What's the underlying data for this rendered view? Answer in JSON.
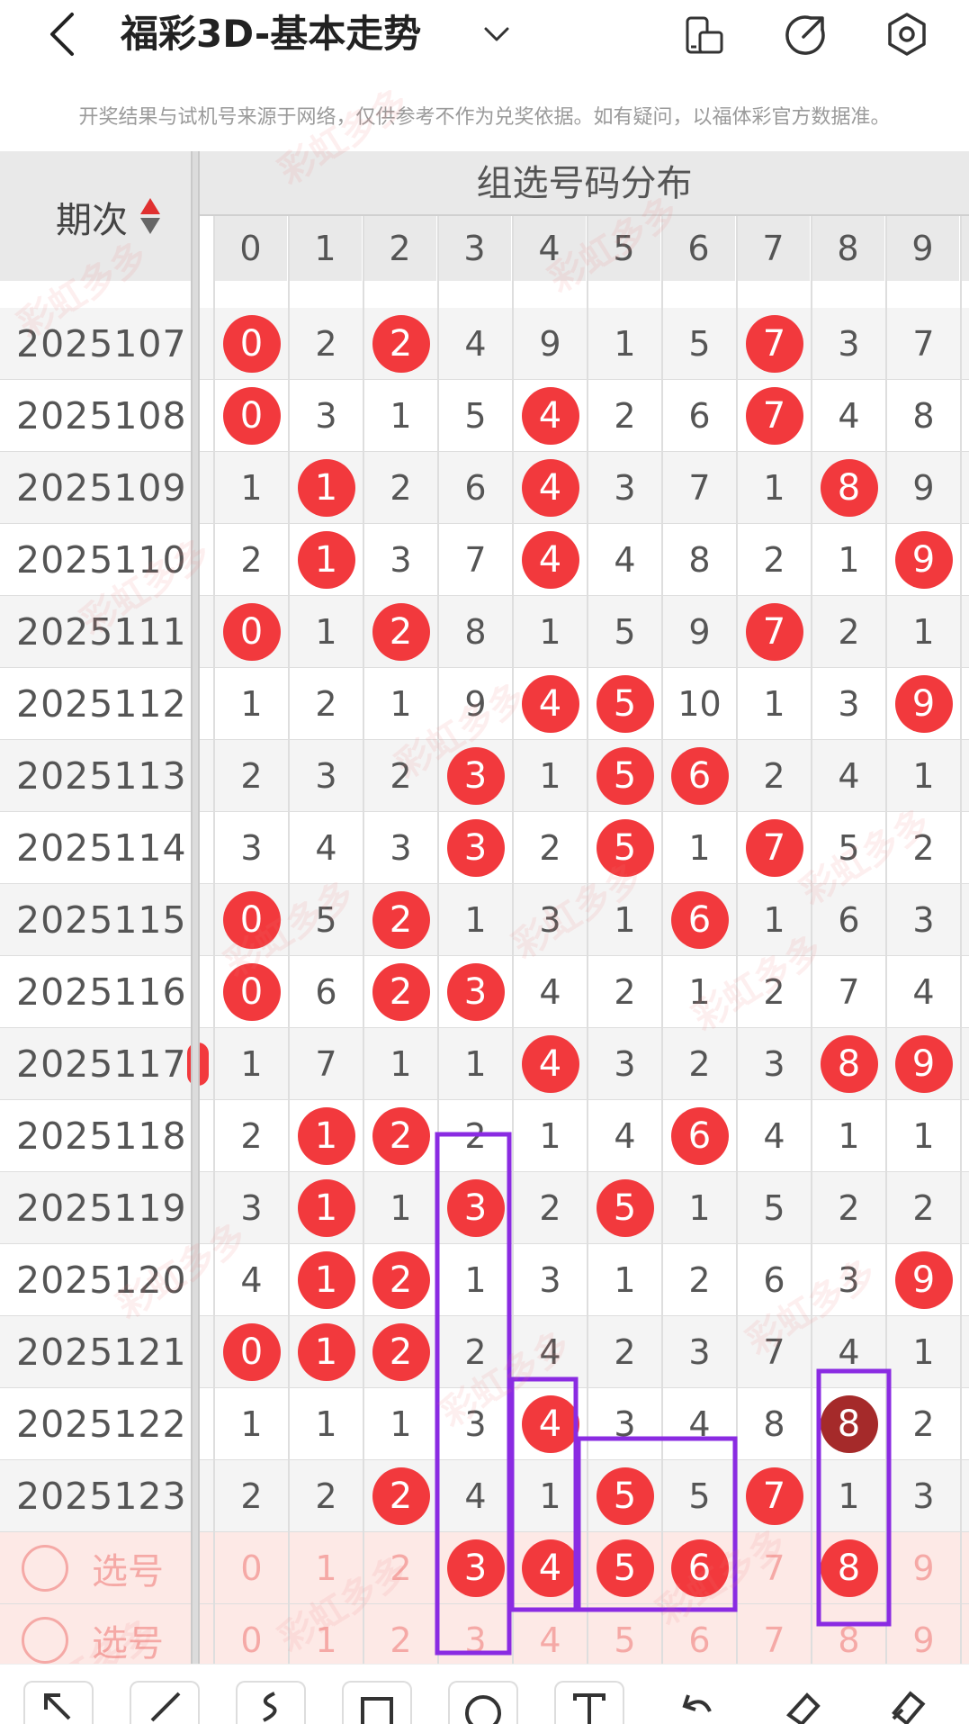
{
  "header": {
    "title": "福彩3D-基本走势",
    "icons": [
      "back-arrow-icon",
      "chevron-down-icon",
      "phone-rotate-icon",
      "share-icon",
      "settings-icon"
    ]
  },
  "disclaimer": "开奖结果与试机号来源于网络，仅供参考不作为兑奖依据。如有疑问，以福体彩官方数据准。",
  "table": {
    "period_header": "期次",
    "group_header": "组选号码分布",
    "digits": [
      "0",
      "1",
      "2",
      "3",
      "4",
      "5",
      "6",
      "7",
      "8",
      "9"
    ],
    "rows": [
      {
        "period": "2025107",
        "cells": [
          "0",
          "2",
          "2",
          "4",
          "9",
          "1",
          "5",
          "7",
          "3",
          "7"
        ],
        "hits": [
          0,
          2,
          7
        ]
      },
      {
        "period": "2025108",
        "cells": [
          "0",
          "3",
          "1",
          "5",
          "4",
          "2",
          "6",
          "7",
          "4",
          "8"
        ],
        "hits": [
          0,
          4,
          7
        ]
      },
      {
        "period": "2025109",
        "cells": [
          "1",
          "1",
          "2",
          "6",
          "4",
          "3",
          "7",
          "1",
          "8",
          "9"
        ],
        "hits": [
          1,
          4,
          8
        ]
      },
      {
        "period": "2025110",
        "cells": [
          "2",
          "1",
          "3",
          "7",
          "4",
          "4",
          "8",
          "2",
          "1",
          "9"
        ],
        "hits": [
          1,
          4,
          9
        ]
      },
      {
        "period": "2025111",
        "cells": [
          "0",
          "1",
          "2",
          "8",
          "1",
          "5",
          "9",
          "7",
          "2",
          "1"
        ],
        "hits": [
          0,
          2,
          7
        ]
      },
      {
        "period": "2025112",
        "cells": [
          "1",
          "2",
          "1",
          "9",
          "4",
          "5",
          "10",
          "1",
          "3",
          "9"
        ],
        "hits": [
          4,
          5,
          9
        ]
      },
      {
        "period": "2025113",
        "cells": [
          "2",
          "3",
          "2",
          "3",
          "1",
          "5",
          "6",
          "2",
          "4",
          "1"
        ],
        "hits": [
          3,
          5,
          6
        ]
      },
      {
        "period": "2025114",
        "cells": [
          "3",
          "4",
          "3",
          "3",
          "2",
          "5",
          "1",
          "7",
          "5",
          "2"
        ],
        "hits": [
          3,
          5,
          7
        ]
      },
      {
        "period": "2025115",
        "cells": [
          "0",
          "5",
          "2",
          "1",
          "3",
          "1",
          "6",
          "1",
          "6",
          "3"
        ],
        "hits": [
          0,
          2,
          6
        ]
      },
      {
        "period": "2025116",
        "cells": [
          "0",
          "6",
          "2",
          "3",
          "4",
          "2",
          "1",
          "2",
          "7",
          "4"
        ],
        "hits": [
          0,
          2,
          3
        ]
      },
      {
        "period": "2025117",
        "cells": [
          "1",
          "7",
          "1",
          "1",
          "4",
          "3",
          "2",
          "3",
          "8",
          "9"
        ],
        "hits": [
          4,
          8,
          9
        ]
      },
      {
        "period": "2025118",
        "cells": [
          "2",
          "1",
          "2",
          "2",
          "1",
          "4",
          "6",
          "4",
          "1",
          "1"
        ],
        "hits": [
          1,
          2,
          6
        ]
      },
      {
        "period": "2025119",
        "cells": [
          "3",
          "1",
          "1",
          "3",
          "2",
          "5",
          "1",
          "5",
          "2",
          "2"
        ],
        "hits": [
          1,
          3,
          5
        ]
      },
      {
        "period": "2025120",
        "cells": [
          "4",
          "1",
          "2",
          "1",
          "3",
          "1",
          "2",
          "6",
          "3",
          "9"
        ],
        "hits": [
          1,
          2,
          9
        ]
      },
      {
        "period": "2025121",
        "cells": [
          "0",
          "1",
          "2",
          "2",
          "4",
          "2",
          "3",
          "7",
          "4",
          "1"
        ],
        "hits": [
          0,
          1,
          2
        ]
      },
      {
        "period": "2025122",
        "cells": [
          "1",
          "1",
          "1",
          "3",
          "4",
          "3",
          "4",
          "8",
          "8",
          "2"
        ],
        "hits": [
          4,
          8
        ],
        "dark": [
          8
        ]
      },
      {
        "period": "2025123",
        "cells": [
          "2",
          "2",
          "2",
          "4",
          "1",
          "5",
          "5",
          "7",
          "1",
          "3"
        ],
        "hits": [
          2,
          5,
          7
        ]
      }
    ],
    "pick_rows": [
      {
        "label": "选号",
        "cells": [
          "0",
          "1",
          "2",
          "3",
          "4",
          "5",
          "6",
          "7",
          "8",
          "9"
        ],
        "hits": [
          3,
          4,
          5,
          6,
          8
        ]
      },
      {
        "label": "选号",
        "cells": [
          "0",
          "1",
          "2",
          "3",
          "4",
          "5",
          "6",
          "7",
          "8",
          "9"
        ],
        "hits": []
      }
    ]
  },
  "watermark_text": "彩虹多多",
  "colors": {
    "hit": "#f2393d",
    "hit_dark": "#a52a2a",
    "highlight_box": "#8a2be2",
    "pick_bg": "#fde9e6"
  },
  "toolbar": {
    "tools": [
      "arrow-tool-icon",
      "line-tool-icon",
      "freehand-tool-icon",
      "rectangle-tool-icon",
      "circle-tool-icon",
      "text-tool-icon",
      "undo-icon",
      "eraser-icon",
      "clear-icon"
    ]
  }
}
